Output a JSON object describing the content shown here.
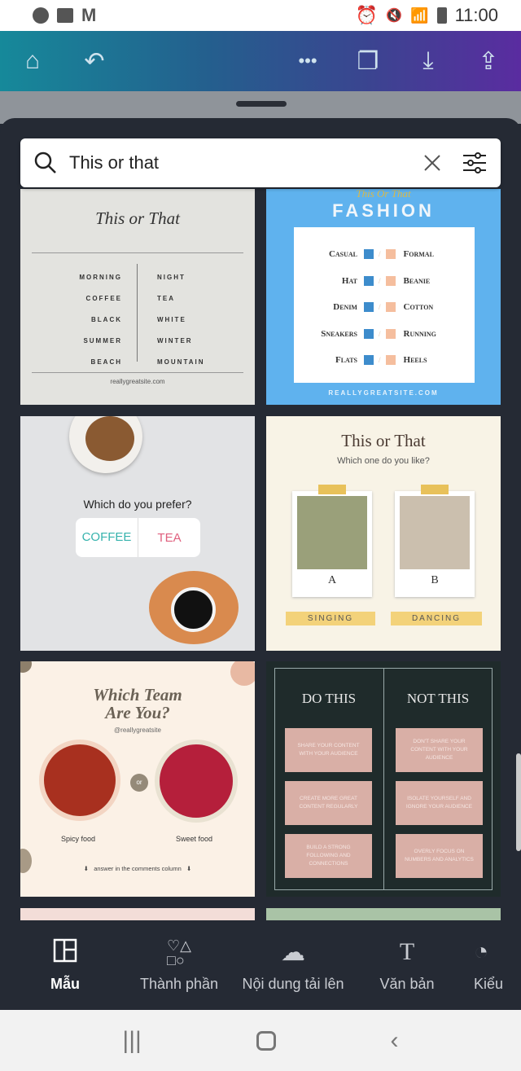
{
  "status_bar": {
    "time": "11:00",
    "left_icons": [
      "line-icon",
      "gallery-icon",
      "gmail-icon"
    ],
    "right_icons": [
      "alarm-icon",
      "mute-icon",
      "wifi-icon",
      "signal-icon",
      "battery-charging-icon"
    ]
  },
  "toolbar": {
    "icons": [
      "home-icon",
      "undo-icon",
      "more-icon",
      "pages-icon",
      "download-icon",
      "share-icon"
    ]
  },
  "search": {
    "value": "This or that"
  },
  "templates": {
    "t1": {
      "title": "This or That",
      "left": [
        "MORNING",
        "COFFEE",
        "BLACK",
        "SUMMER",
        "BEACH"
      ],
      "right": [
        "NIGHT",
        "TEA",
        "WHITE",
        "WINTER",
        "MOUNTAIN"
      ],
      "footer": "reallygreatsite.com"
    },
    "t2": {
      "subtitle": "This Or That",
      "title": "FASHION",
      "left": [
        "Casual",
        "Hat",
        "Denim",
        "Sneakers",
        "Flats"
      ],
      "right": [
        "Formal",
        "Beanie",
        "Cotton",
        "Running",
        "Heels"
      ],
      "footer": "REALLYGREATSITE.COM"
    },
    "t3": {
      "question": "Which do you prefer?",
      "option_a": "COFFEE",
      "option_b": "TEA"
    },
    "t4": {
      "title": "This or That",
      "subtitle": "Which one do you like?",
      "label_a": "A",
      "label_b": "B",
      "caption_a": "SINGING",
      "caption_b": "DANCING"
    },
    "t5": {
      "title_1": "Which Team",
      "title_2": "Are You?",
      "handle": "@reallygreatsite",
      "or": "or",
      "option_a": "Spicy food",
      "option_b": "Sweet food",
      "footer": "answer in the comments column"
    },
    "t6": {
      "left_title": "DO THIS",
      "right_title": "NOT THIS",
      "left": [
        "SHARE YOUR CONTENT WITH YOUR AUDIENCE",
        "CREATE MORE GREAT CONTENT REGULARLY",
        "BUILD A STRONG FOLLOWING AND CONNECTIONS"
      ],
      "right": [
        "DON'T SHARE YOUR CONTENT WITH YOUR AUDIENCE",
        "ISOLATE YOURSELF AND IGNORE YOUR AUDIENCE",
        "OVERLY FOCUS ON NUMBERS AND ANALYTICS"
      ]
    }
  },
  "bottom_nav": [
    {
      "label": "Mẫu",
      "icon": "template-icon",
      "active": true
    },
    {
      "label": "Thành phần",
      "icon": "elements-icon"
    },
    {
      "label": "Nội dung tải lên",
      "icon": "upload-cloud-icon"
    },
    {
      "label": "Văn bản",
      "icon": "text-icon"
    },
    {
      "label": "Kiểu",
      "icon": "palette-icon"
    }
  ],
  "colors": {
    "toolbar_start": "#16899a",
    "toolbar_end": "#5a2ca0",
    "panel": "#252a34"
  }
}
